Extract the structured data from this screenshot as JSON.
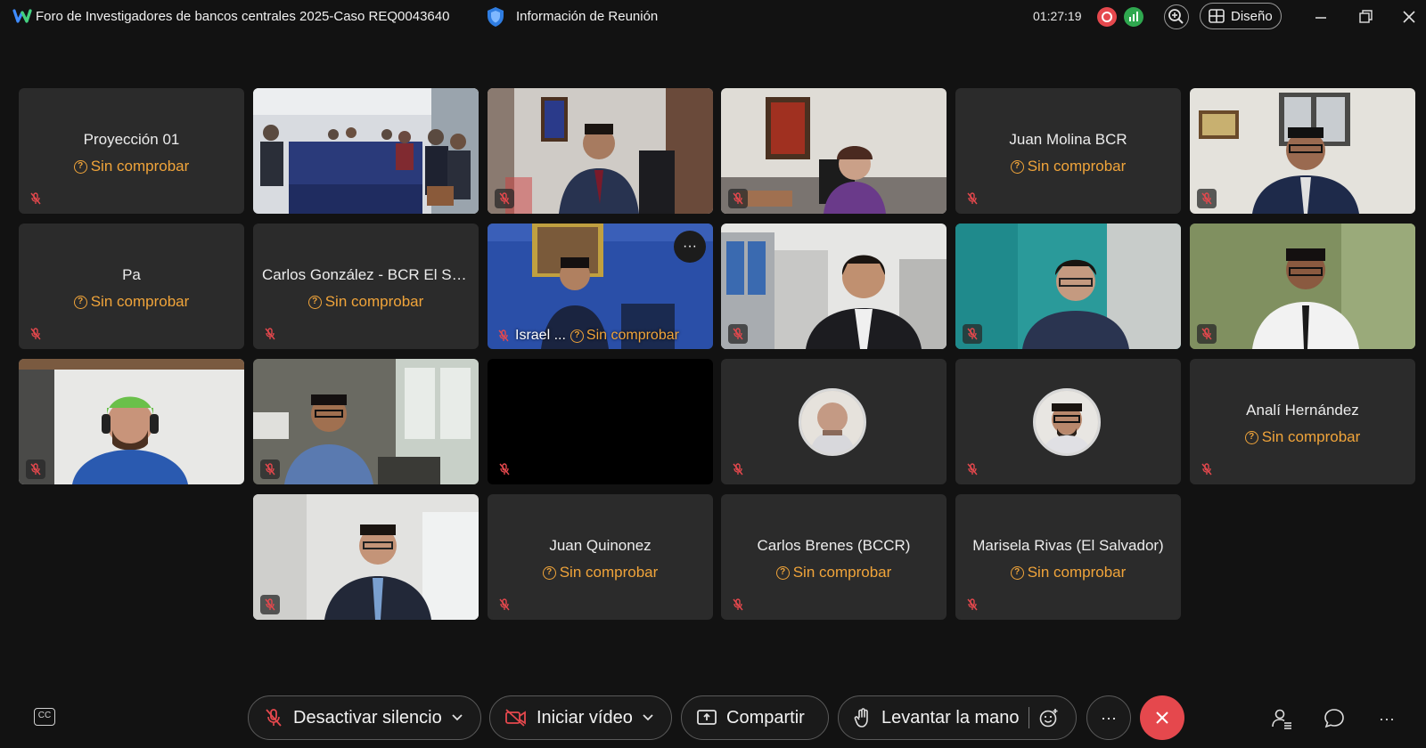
{
  "titlebar": {
    "meeting_title": "Foro de Investigadores de bancos centrales 2025-Caso REQ0043640",
    "meeting_info": "Información de Reunión",
    "timer": "01:27:19",
    "layout_label": "Diseño",
    "recording_color": "#e5484d",
    "network_color": "#2fa84f"
  },
  "status_text": "Sin comprobar",
  "tiles": {
    "proyeccion": {
      "name": "Proyección 01"
    },
    "juan_molina": {
      "name": "Juan Molina BCR"
    },
    "pa": {
      "name": "Pa"
    },
    "carlos_gonzalez": {
      "name": "Carlos González - BCR El Sa..."
    },
    "israel": {
      "name": "Israel ..."
    },
    "anali": {
      "name": "Analí Hernández"
    },
    "juan_quinonez": {
      "name": "Juan Quinonez"
    },
    "carlos_brenes": {
      "name": "Carlos Brenes (BCCR)"
    },
    "marisela": {
      "name": "Marisela Rivas (El Salvador)"
    }
  },
  "toolbar": {
    "unmute_label": "Desactivar silencio",
    "video_label": "Iniciar vídeo",
    "share_label": "Compartir",
    "raise_hand_label": "Levantar la mano",
    "more_label": "···",
    "cc_label": "CC",
    "end_color": "#e5484d"
  }
}
